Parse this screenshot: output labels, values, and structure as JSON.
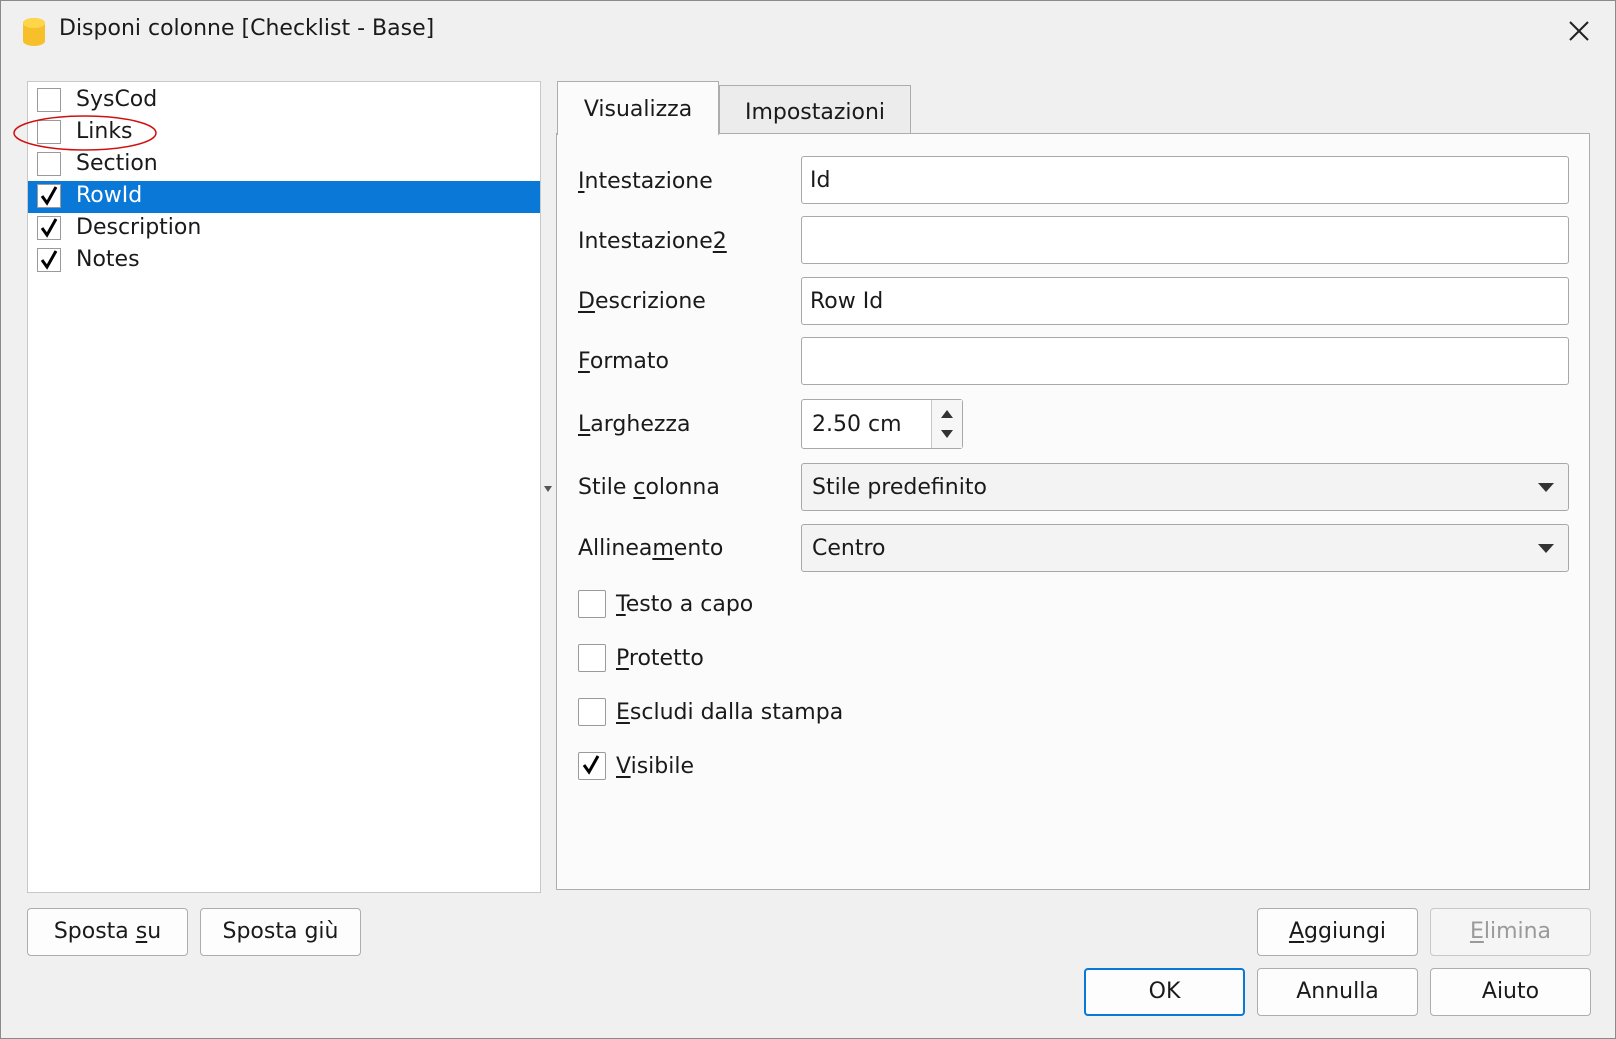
{
  "window": {
    "title": "Disponi colonne [Checklist - Base]",
    "close_icon": "close-icon",
    "app_icon": "banana-app-icon",
    "accent_color": "#0a78d7"
  },
  "columns_list": {
    "items": [
      {
        "label": "SysCod",
        "checked": false,
        "selected": false
      },
      {
        "label": "Links",
        "checked": false,
        "selected": false
      },
      {
        "label": "Section",
        "checked": false,
        "selected": false
      },
      {
        "label": "RowId",
        "checked": true,
        "selected": true
      },
      {
        "label": "Description",
        "checked": true,
        "selected": false
      },
      {
        "label": "Notes",
        "checked": true,
        "selected": false
      }
    ]
  },
  "tabs": [
    {
      "label": "Visualizza",
      "active": true
    },
    {
      "label": "Impostazioni",
      "active": false
    }
  ],
  "form": {
    "intestazione": {
      "label_pre": "",
      "label_u": "I",
      "label_post": "ntestazione",
      "value": "Id"
    },
    "intestazione2": {
      "label_pre": "Intestazione",
      "label_u": "2",
      "label_post": "",
      "value": ""
    },
    "descrizione": {
      "label_pre": "",
      "label_u": "D",
      "label_post": "escrizione",
      "value": "Row Id"
    },
    "formato": {
      "label_pre": "",
      "label_u": "F",
      "label_post": "ormato",
      "value": ""
    },
    "larghezza": {
      "label_pre": "",
      "label_u": "L",
      "label_post": "arghezza",
      "value": "2.50 cm"
    },
    "stile_colonna": {
      "label_pre": "Stile ",
      "label_u": "c",
      "label_post": "olonna",
      "value": "Stile predefinito"
    },
    "allineamento": {
      "label_pre": "Allinea",
      "label_u": "m",
      "label_post": "ento",
      "value": "Centro"
    }
  },
  "options": [
    {
      "label_u": "T",
      "label_post": "esto a capo",
      "checked": false
    },
    {
      "label_u": "P",
      "label_post": "rotetto",
      "checked": false
    },
    {
      "label_u": "E",
      "label_post": "scludi dalla stampa",
      "checked": false
    },
    {
      "label_u": "V",
      "label_post": "isibile",
      "checked": true
    }
  ],
  "buttons": {
    "sposta_su": {
      "pre": "Sposta ",
      "u": "s",
      "post": "u"
    },
    "sposta_giu": {
      "pre": "Sposta giù",
      "u": "",
      "post": ""
    },
    "aggiungi": {
      "pre": "",
      "u": "A",
      "post": "ggiungi"
    },
    "elimina": {
      "pre": "",
      "u": "E",
      "post": "limina"
    },
    "ok": "OK",
    "annulla": "Annulla",
    "aiuto": "Aiuto"
  }
}
